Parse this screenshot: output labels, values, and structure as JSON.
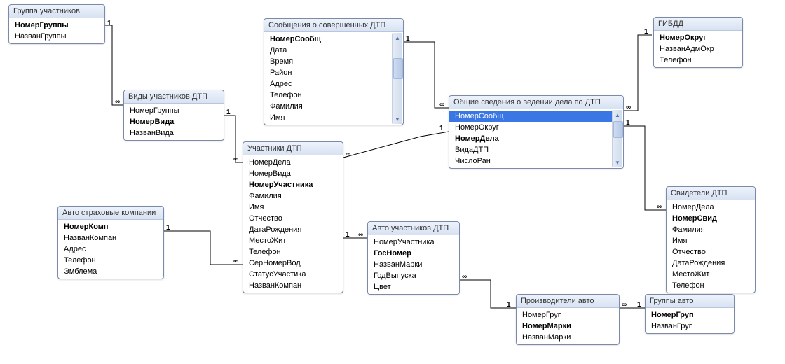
{
  "entities": [
    {
      "title": "Группа участников",
      "fields": [
        {
          "name": "НомерГруппы",
          "pk": true
        },
        {
          "name": "НазванГруппы"
        }
      ]
    },
    {
      "title": "Виды участников ДТП",
      "fields": [
        {
          "name": "НомерГруппы"
        },
        {
          "name": "НомерВида",
          "pk": true
        },
        {
          "name": "НазванВида"
        }
      ]
    },
    {
      "title": "Сообщения о совершенных ДТП",
      "has_scrollbar": true,
      "fields": [
        {
          "name": "НомерСообщ",
          "pk": true
        },
        {
          "name": "Дата"
        },
        {
          "name": "Время"
        },
        {
          "name": "Район"
        },
        {
          "name": "Адрес"
        },
        {
          "name": "Телефон"
        },
        {
          "name": "Фамилия"
        },
        {
          "name": "Имя"
        }
      ]
    },
    {
      "title": "Участники ДТП",
      "fields": [
        {
          "name": "НомерДела"
        },
        {
          "name": "НомерВида"
        },
        {
          "name": "НомерУчастника",
          "pk": true
        },
        {
          "name": "Фамилия"
        },
        {
          "name": "Имя"
        },
        {
          "name": "Отчество"
        },
        {
          "name": "ДатаРождения"
        },
        {
          "name": "МестоЖит"
        },
        {
          "name": "Телефон"
        },
        {
          "name": "СерНомерВод"
        },
        {
          "name": "СтатусУчастика"
        },
        {
          "name": "НазванКомпан"
        }
      ]
    },
    {
      "title": "Авто страховые компании",
      "fields": [
        {
          "name": "НомерКомп",
          "pk": true
        },
        {
          "name": "НазванКомпан"
        },
        {
          "name": "Адрес"
        },
        {
          "name": "Телефон"
        },
        {
          "name": "Эмблема"
        }
      ]
    },
    {
      "title": "Общие сведения о ведении дела по ДТП",
      "has_scrollbar": true,
      "fields": [
        {
          "name": "НомерСообщ",
          "selected": true
        },
        {
          "name": "НомерОкруг"
        },
        {
          "name": "НомерДела",
          "pk": true
        },
        {
          "name": "ВидаДТП"
        },
        {
          "name": "ЧислоРан"
        }
      ]
    },
    {
      "title": "ГИБДД",
      "fields": [
        {
          "name": "НомерОкруг",
          "pk": true
        },
        {
          "name": "НазванАдмОкр"
        },
        {
          "name": "Телефон"
        }
      ]
    },
    {
      "title": "Свидетели ДТП",
      "fields": [
        {
          "name": "НомерДела"
        },
        {
          "name": "НомерСвид",
          "pk": true
        },
        {
          "name": "Фамилия"
        },
        {
          "name": "Имя"
        },
        {
          "name": "Отчество"
        },
        {
          "name": "ДатаРождения"
        },
        {
          "name": "МестоЖит"
        },
        {
          "name": "Телефон"
        }
      ]
    },
    {
      "title": "Авто участников ДТП",
      "fields": [
        {
          "name": "НомерУчастника"
        },
        {
          "name": "ГосНомер",
          "pk": true
        },
        {
          "name": "НазванМарки"
        },
        {
          "name": "ГодВыпуска"
        },
        {
          "name": "Цвет"
        }
      ]
    },
    {
      "title": "Производители авто",
      "fields": [
        {
          "name": "НомерГруп"
        },
        {
          "name": "НомерМарки",
          "pk": true
        },
        {
          "name": "НазванМарки"
        }
      ]
    },
    {
      "title": "Группы авто",
      "fields": [
        {
          "name": "НомерГруп",
          "pk": true
        },
        {
          "name": "НазванГруп"
        }
      ]
    }
  ],
  "relations": [
    {
      "from": "1",
      "to": "∞",
      "from_entity": "Группа участников",
      "to_entity": "Виды участников ДТП"
    },
    {
      "from": "1",
      "to": "∞",
      "from_entity": "Виды участников ДТП",
      "to_entity": "Участники ДТП"
    },
    {
      "from": "1",
      "to": "∞",
      "from_entity": "Авто страховые компании",
      "to_entity": "Участники ДТП"
    },
    {
      "from": "1",
      "to": "∞",
      "from_entity": "Сообщения о совершенных ДТП",
      "to_entity": "Общие сведения о ведении дела по ДТП"
    },
    {
      "from": "∞",
      "to": "1",
      "from_entity": "Участники ДТП",
      "to_entity": "Общие сведения о ведении дела по ДТП"
    },
    {
      "from": "1",
      "to": "∞",
      "from_entity": "Участники ДТП",
      "to_entity": "Авто участников ДТП"
    },
    {
      "from": "∞",
      "to": "1",
      "from_entity": "Авто участников ДТП",
      "to_entity": "Производители авто"
    },
    {
      "from": "∞",
      "to": "1",
      "from_entity": "Производители авто",
      "to_entity": "Группы авто"
    },
    {
      "from": "∞",
      "to": "1",
      "from_entity": "Общие сведения о ведении дела по ДТП",
      "to_entity": "ГИБДД"
    },
    {
      "from": "1",
      "to": "∞",
      "from_entity": "Общие сведения о ведении дела по ДТП",
      "to_entity": "Свидетели ДТП"
    }
  ],
  "colors": {
    "entity_border": "#7a8aa8",
    "header_gradient_from": "#eef3fb",
    "header_gradient_to": "#d7e2f2",
    "selected_row": "#3a77e5"
  }
}
